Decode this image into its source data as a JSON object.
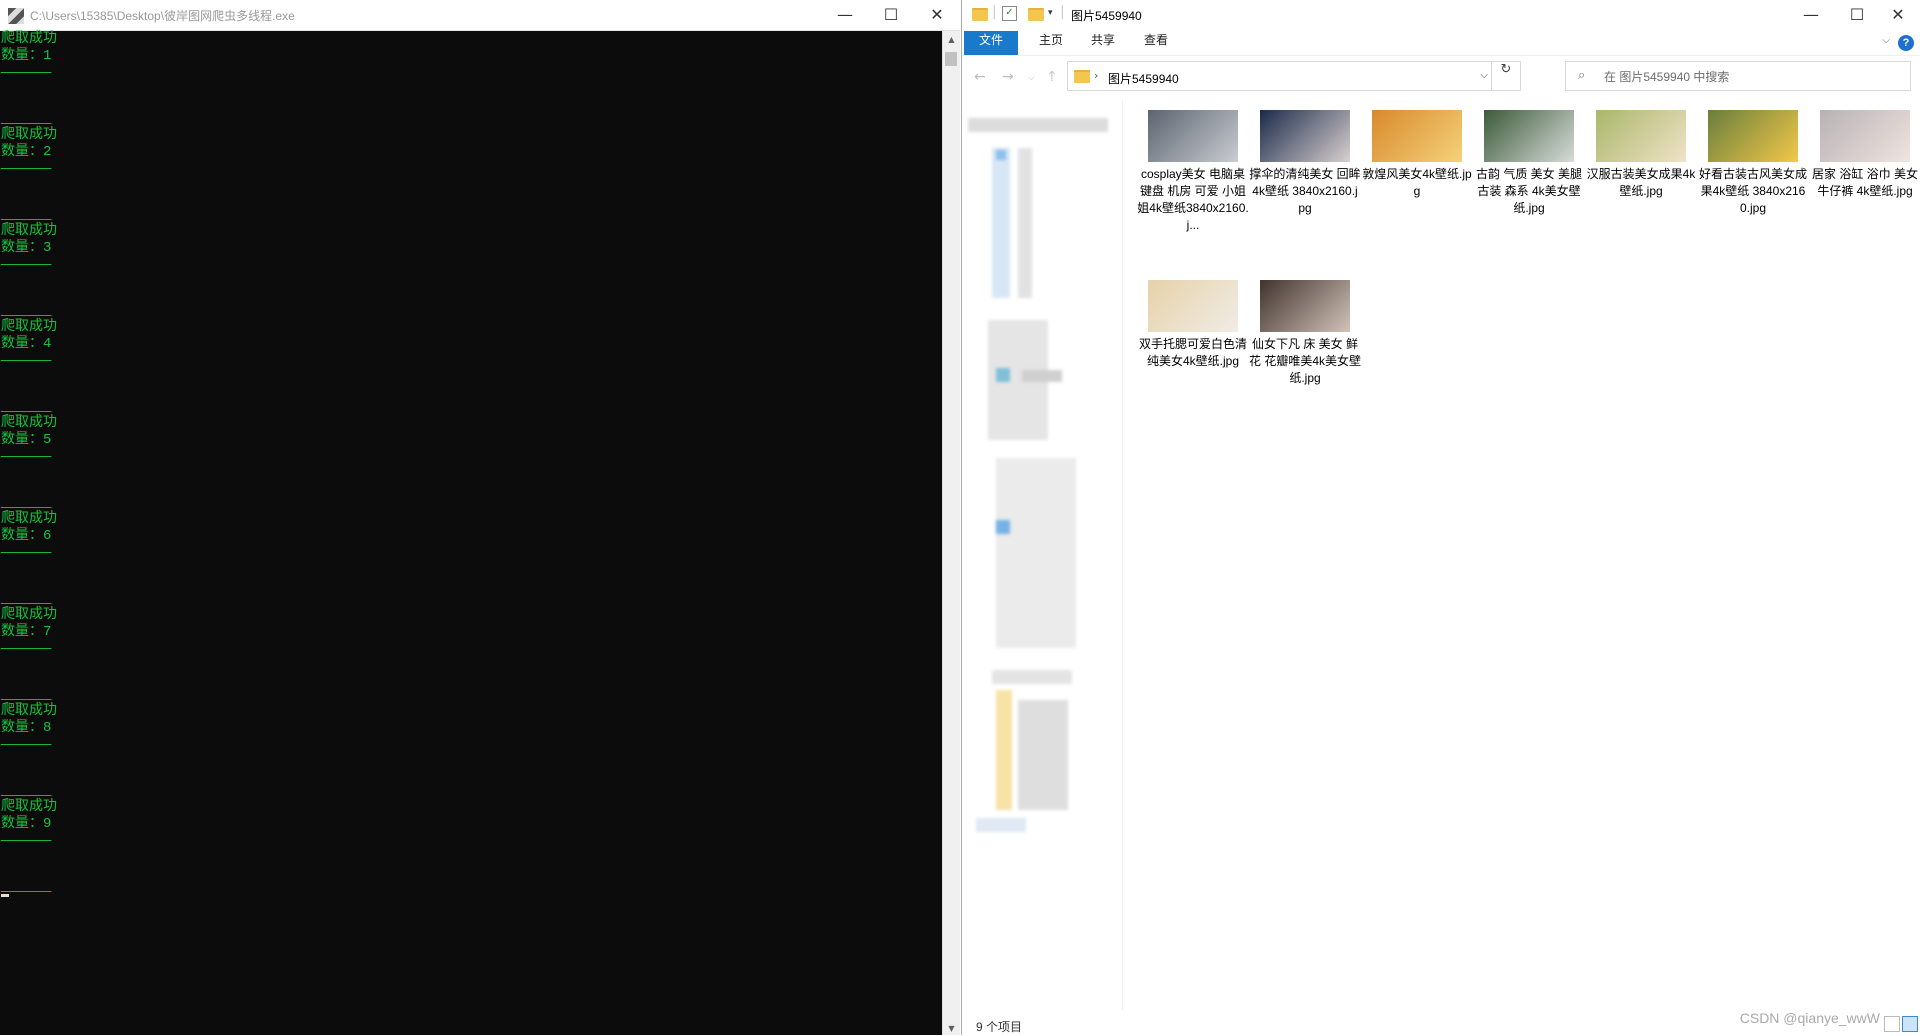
{
  "console": {
    "title": "C:\\Users\\15385\\Desktop\\彼岸图网爬虫多线程.exe",
    "separator": "——————",
    "success_label": "爬取成功",
    "entries": [
      {
        "count_line": "数量：1"
      },
      {
        "count_line": "数量：2"
      },
      {
        "count_line": "数量：3"
      },
      {
        "count_line": "数量：4"
      },
      {
        "count_line": "数量：5"
      },
      {
        "count_line": "数量：6"
      },
      {
        "count_line": "数量：7"
      },
      {
        "count_line": "数量：8"
      },
      {
        "count_line": "数量：9"
      }
    ],
    "controls": {
      "minimize": "—",
      "maximize": "☐",
      "close": "✕"
    }
  },
  "explorer": {
    "title": "图片5459940",
    "controls": {
      "minimize": "—",
      "maximize": "☐",
      "close": "✕"
    },
    "ribbon_tabs": [
      {
        "label": "文件",
        "active": true
      },
      {
        "label": "主页",
        "active": false
      },
      {
        "label": "共享",
        "active": false
      },
      {
        "label": "查看",
        "active": false
      }
    ],
    "address": "图片5459940",
    "search_placeholder": "在 图片5459940 中搜索",
    "files": [
      {
        "name": "cosplay美女 电脑桌 键盘 机房 可爱 小姐姐4k壁纸3840x2160.j...",
        "colors": [
          "#5c6470",
          "#c9ccd1"
        ]
      },
      {
        "name": "撑伞的清纯美女 回眸4k壁纸 3840x2160.jpg",
        "colors": [
          "#1b2a4a",
          "#d8d0cf"
        ]
      },
      {
        "name": "敦煌风美女4k壁纸.jpg",
        "colors": [
          "#d9892c",
          "#f5d27a"
        ]
      },
      {
        "name": "古韵 气质 美女 美腿 古装 森系 4k美女壁纸.jpg",
        "colors": [
          "#3d5a3a",
          "#d7dcd9"
        ]
      },
      {
        "name": "汉服古装美女成果4k壁纸.jpg",
        "colors": [
          "#a9b76a",
          "#f1e2c8"
        ]
      },
      {
        "name": "好看古装古风美女成果4k壁纸 3840x2160.jpg",
        "colors": [
          "#6a7e3c",
          "#f2c84a"
        ]
      },
      {
        "name": "居家 浴缸 浴巾 美女 牛仔裤 4k壁纸.jpg",
        "colors": [
          "#b8b2b4",
          "#efe4e0"
        ]
      },
      {
        "name": "双手托腮可爱白色清纯美女4k壁纸.jpg",
        "colors": [
          "#e6d2a8",
          "#f0ece6"
        ]
      },
      {
        "name": "仙女下凡 床 美女 鲜花 花瓣唯美4k美女壁纸.jpg",
        "colors": [
          "#40332d",
          "#d2c3b8"
        ]
      }
    ],
    "status": "9 个项目",
    "watermark": "CSDN @qianye_wwW"
  }
}
